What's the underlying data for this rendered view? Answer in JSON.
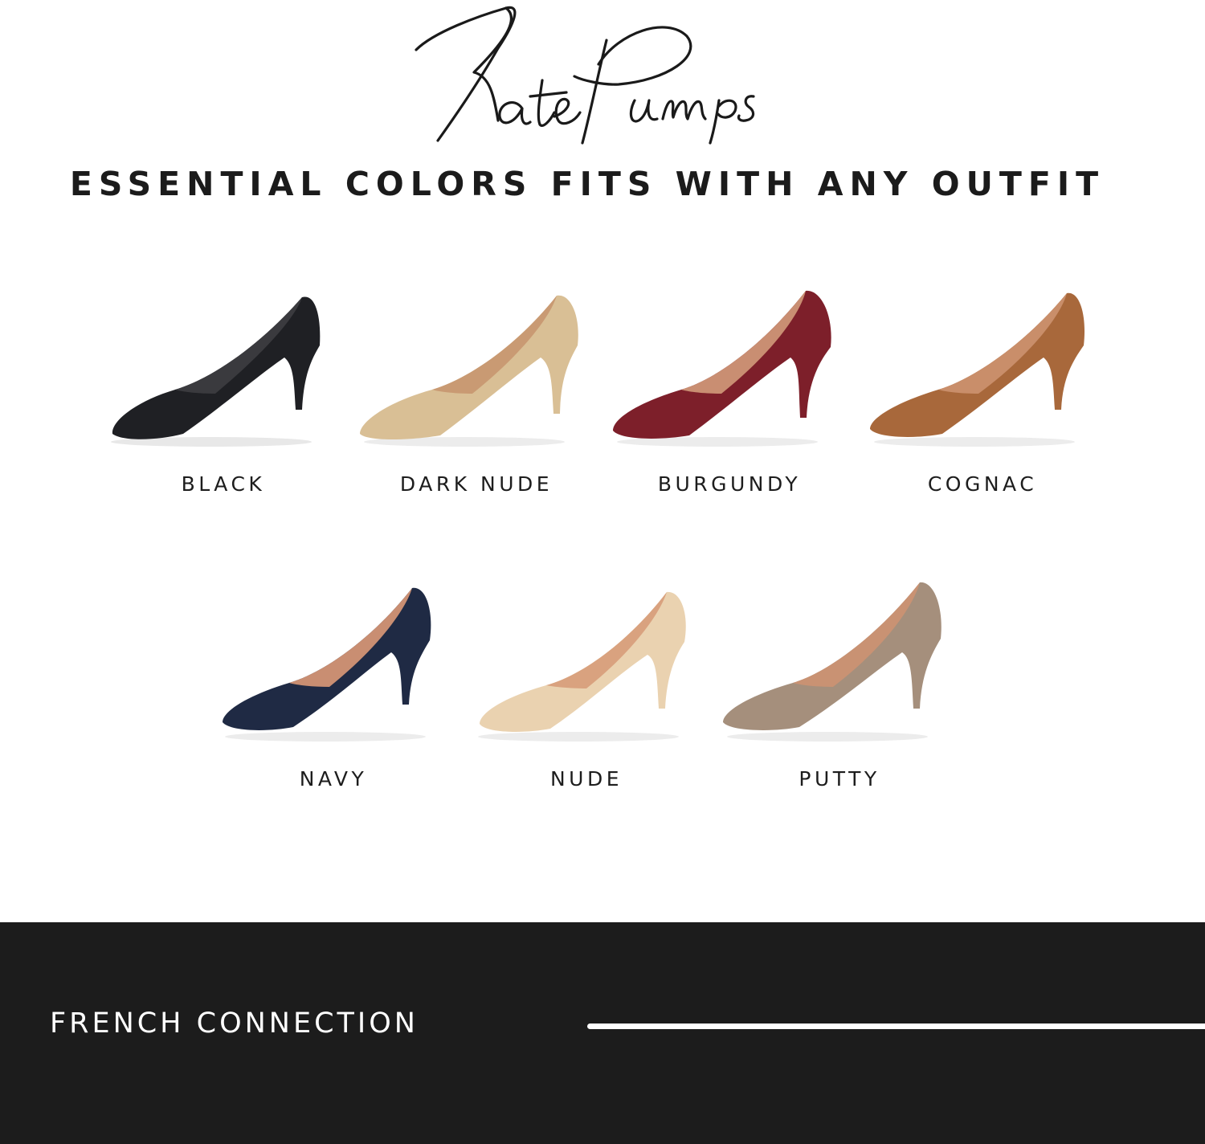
{
  "header": {
    "script_title": "Kate Pumps",
    "headline": "ESSENTIAL COLORS FITS WITH ANY OUTFIT"
  },
  "colors_row1": [
    {
      "label": "BLACK",
      "color": "#1f2024",
      "lining": "#3a3a3e"
    },
    {
      "label": "DARK NUDE",
      "color": "#d9bf95",
      "lining": "#c99a73"
    },
    {
      "label": "BURGUNDY",
      "color": "#7d1f2a",
      "lining": "#c98e72"
    },
    {
      "label": "COGNAC",
      "color": "#a8683b",
      "lining": "#c98e6a"
    }
  ],
  "colors_row2": [
    {
      "label": "NAVY",
      "color": "#1f2a44",
      "lining": "#c98e72"
    },
    {
      "label": "NUDE",
      "color": "#ead2b0",
      "lining": "#d9a27f"
    },
    {
      "label": "PUTTY",
      "color": "#a58f7c",
      "lining": "#c99273"
    }
  ],
  "footer": {
    "brand": "FRENCH CONNECTION"
  }
}
